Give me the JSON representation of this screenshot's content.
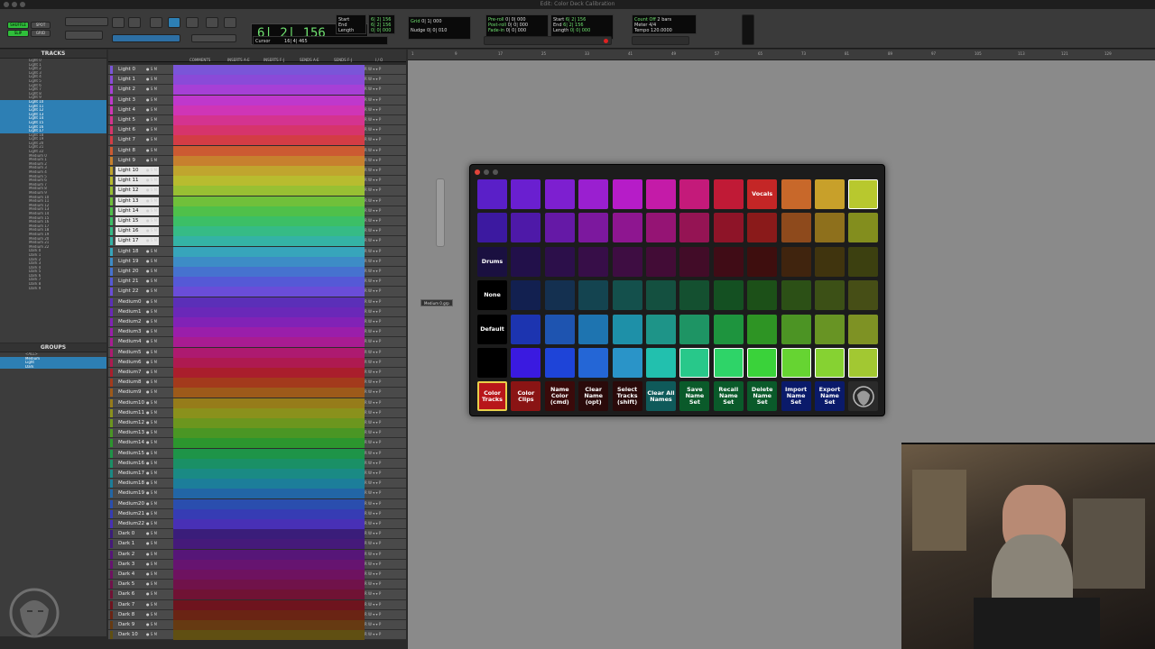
{
  "window": {
    "title": "Edit: Color Deck Calibration"
  },
  "toolbar": {
    "mode_buttons": [
      "SHUFFLE",
      "SPOT",
      "SLIP",
      "GRID"
    ],
    "counter": "6| 2| 156",
    "start_label": "Start",
    "end_label": "End",
    "length_label": "Length",
    "start": "6| 2| 156",
    "end": "6| 2| 156",
    "length": "0| 0| 000",
    "cursor_label": "Cursor",
    "cursor": "16| 4| 465",
    "grid_label": "Grid",
    "nudge_label": "Nudge",
    "grid": "0| 1| 000",
    "nudge": "0| 0| 010",
    "preroll_label": "Pre-roll",
    "postroll_label": "Post-roll",
    "fadein_label": "Fade-in",
    "preroll": "0| 0| 000",
    "postroll": "0| 0| 000",
    "fadein": "0| 0| 000",
    "pstart_label": "Start",
    "pend_label": "End",
    "plength_label": "Length",
    "pstart": "6| 2| 156",
    "pend": "6| 2| 156",
    "plength": "0| 0| 000",
    "countoff": "Count Off",
    "meter_label": "Meter",
    "tempo_label": "Tempo",
    "countoff_val": "2 bars",
    "meter": "4/4",
    "tempo": "120.0000"
  },
  "panels": {
    "tracks_title": "TRACKS",
    "groups_title": "GROUPS"
  },
  "track_list": [
    "Light 0",
    "Light 1",
    "Light 2",
    "Light 3",
    "Light 4",
    "Light 5",
    "Light 6",
    "Light 7",
    "Light 8",
    "Light 9",
    "Light 10",
    "Light 11",
    "Light 12",
    "Light 13",
    "Light 14",
    "Light 15",
    "Light 16",
    "Light 17",
    "Light 18",
    "Light 19",
    "Light 20",
    "Light 21",
    "Light 22",
    "Medium 0",
    "Medium 1",
    "Medium 2",
    "Medium 3",
    "Medium 4",
    "Medium 5",
    "Medium 6",
    "Medium 7",
    "Medium 8",
    "Medium 9",
    "Medium 10",
    "Medium 11",
    "Medium 12",
    "Medium 13",
    "Medium 14",
    "Medium 15",
    "Medium 16",
    "Medium 17",
    "Medium 18",
    "Medium 19",
    "Medium 20",
    "Medium 21",
    "Medium 22",
    "Dark 0",
    "Dark 1",
    "Dark 2",
    "Dark 3",
    "Dark 4",
    "Dark 5",
    "Dark 6",
    "Dark 7",
    "Dark 8",
    "Dark 9"
  ],
  "groups": [
    "<ALL>",
    "Medium",
    "Light",
    "Dark"
  ],
  "mix_headers": {
    "comments": "COMMENTS",
    "inserts_ae": "INSERTS A-E",
    "inserts_fj": "INSERTS F-J",
    "sends_ae": "SENDS A-E",
    "sends_fj": "SENDS F-J",
    "io": "I / O"
  },
  "tracks": [
    {
      "name": "Light 0",
      "color": "#7a55d8"
    },
    {
      "name": "Light 1",
      "color": "#8a4ad8"
    },
    {
      "name": "Light 2",
      "color": "#a640d6"
    },
    {
      "name": "Light 3",
      "color": "#bf38cc"
    },
    {
      "name": "Light 4",
      "color": "#cf35b6"
    },
    {
      "name": "Light 5",
      "color": "#d4338f"
    },
    {
      "name": "Light 6",
      "color": "#d6346b"
    },
    {
      "name": "Light 7",
      "color": "#d33c45"
    },
    {
      "name": "Light 8",
      "color": "#cc5a32"
    },
    {
      "name": "Light 9",
      "color": "#c7802e"
    },
    {
      "name": "Light 10",
      "color": "#c0a52e",
      "sel": true
    },
    {
      "name": "Light 11",
      "color": "#b8bc2f",
      "sel": true
    },
    {
      "name": "Light 12",
      "color": "#98c033",
      "sel": true
    },
    {
      "name": "Light 13",
      "color": "#70c03a",
      "sel": true
    },
    {
      "name": "Light 14",
      "color": "#4fc04a",
      "sel": true
    },
    {
      "name": "Light 15",
      "color": "#3cbf66",
      "sel": true
    },
    {
      "name": "Light 16",
      "color": "#36bb86",
      "sel": true
    },
    {
      "name": "Light 17",
      "color": "#34b3a5",
      "sel": true
    },
    {
      "name": "Light 18",
      "color": "#37a5bb"
    },
    {
      "name": "Light 19",
      "color": "#3d8cc6"
    },
    {
      "name": "Light 20",
      "color": "#4672cf"
    },
    {
      "name": "Light 21",
      "color": "#5559d6"
    },
    {
      "name": "Light 22",
      "color": "#6a4dd8"
    },
    {
      "name": "Medium0",
      "color": "#5b2fb8"
    },
    {
      "name": "Medium1",
      "color": "#6a28b8"
    },
    {
      "name": "Medium2",
      "color": "#8122b6"
    },
    {
      "name": "Medium3",
      "color": "#9a1eaa"
    },
    {
      "name": "Medium4",
      "color": "#a81c92"
    },
    {
      "name": "Medium5",
      "color": "#ad1a70"
    },
    {
      "name": "Medium6",
      "color": "#ae1a50"
    },
    {
      "name": "Medium7",
      "color": "#aa1e2c"
    },
    {
      "name": "Medium8",
      "color": "#a33a1c"
    },
    {
      "name": "Medium9",
      "color": "#9d5a1a"
    },
    {
      "name": "Medium10",
      "color": "#967c1a"
    },
    {
      "name": "Medium11",
      "color": "#8a911c"
    },
    {
      "name": "Medium12",
      "color": "#6c961e"
    },
    {
      "name": "Medium13",
      "color": "#4a9624"
    },
    {
      "name": "Medium14",
      "color": "#2c962e"
    },
    {
      "name": "Medium15",
      "color": "#1e9448"
    },
    {
      "name": "Medium16",
      "color": "#1a9066"
    },
    {
      "name": "Medium17",
      "color": "#1a8a84"
    },
    {
      "name": "Medium18",
      "color": "#1c7e9a"
    },
    {
      "name": "Medium19",
      "color": "#2266a6"
    },
    {
      "name": "Medium20",
      "color": "#2a4eae"
    },
    {
      "name": "Medium21",
      "color": "#363cb4"
    },
    {
      "name": "Medium22",
      "color": "#4830b6"
    },
    {
      "name": "Dark 0",
      "color": "#3a1d7a"
    },
    {
      "name": "Dark 1",
      "color": "#451a7a"
    },
    {
      "name": "Dark 2",
      "color": "#561678"
    },
    {
      "name": "Dark 3",
      "color": "#661470"
    },
    {
      "name": "Dark 4",
      "color": "#6e1260"
    },
    {
      "name": "Dark 5",
      "color": "#70124a"
    },
    {
      "name": "Dark 6",
      "color": "#701234"
    },
    {
      "name": "Dark 7",
      "color": "#6e141e"
    },
    {
      "name": "Dark 8",
      "color": "#6a2414"
    },
    {
      "name": "Dark 9",
      "color": "#663a12"
    },
    {
      "name": "Dark 10",
      "color": "#604f12"
    }
  ],
  "ruler_ticks": [
    "1",
    "9",
    "17",
    "25",
    "33",
    "41",
    "49",
    "57",
    "65",
    "73",
    "81",
    "89",
    "97",
    "105",
    "113",
    "121",
    "129"
  ],
  "tooltip": "Medium 0.grp",
  "deck": {
    "rows": [
      [
        {
          "c": "#5a1fc8",
          "l": ""
        },
        {
          "c": "#6a1fd0",
          "l": ""
        },
        {
          "c": "#7d1fd0",
          "l": ""
        },
        {
          "c": "#9a1fd0",
          "l": ""
        },
        {
          "c": "#b61cc8",
          "l": ""
        },
        {
          "c": "#c41ba8",
          "l": ""
        },
        {
          "c": "#c41a7a",
          "l": ""
        },
        {
          "c": "#c01a36",
          "l": ""
        },
        {
          "c": "#c42626",
          "l": "Vocals"
        },
        {
          "c": "#c8682a",
          "l": ""
        },
        {
          "c": "#c8a02a",
          "l": ""
        },
        {
          "c": "#b8c82e",
          "l": "",
          "sel": true
        }
      ],
      [
        {
          "c": "#3c19a0",
          "l": ""
        },
        {
          "c": "#4e19a8",
          "l": ""
        },
        {
          "c": "#6519a6",
          "l": ""
        },
        {
          "c": "#7c189e",
          "l": ""
        },
        {
          "c": "#8e1690",
          "l": ""
        },
        {
          "c": "#951474",
          "l": ""
        },
        {
          "c": "#951454",
          "l": ""
        },
        {
          "c": "#8e1428",
          "l": ""
        },
        {
          "c": "#8a1a1a",
          "l": ""
        },
        {
          "c": "#8e4a1c",
          "l": ""
        },
        {
          "c": "#8e701c",
          "l": ""
        },
        {
          "c": "#838e1e",
          "l": ""
        }
      ],
      [
        {
          "c": "#1a1040",
          "l": "Drums"
        },
        {
          "c": "#22104a",
          "l": ""
        },
        {
          "c": "#2c0f4a",
          "l": ""
        },
        {
          "c": "#370e48",
          "l": ""
        },
        {
          "c": "#3e0d42",
          "l": ""
        },
        {
          "c": "#420c36",
          "l": ""
        },
        {
          "c": "#420c28",
          "l": ""
        },
        {
          "c": "#400c16",
          "l": ""
        },
        {
          "c": "#3e0e0e",
          "l": ""
        },
        {
          "c": "#40240e",
          "l": ""
        },
        {
          "c": "#40340e",
          "l": ""
        },
        {
          "c": "#3c4010",
          "l": ""
        }
      ],
      [
        {
          "c": "#000000",
          "l": "None"
        },
        {
          "c": "#122050",
          "l": ""
        },
        {
          "c": "#143050",
          "l": ""
        },
        {
          "c": "#144450",
          "l": ""
        },
        {
          "c": "#14504c",
          "l": ""
        },
        {
          "c": "#145040",
          "l": ""
        },
        {
          "c": "#145030",
          "l": ""
        },
        {
          "c": "#145022",
          "l": ""
        },
        {
          "c": "#1c5018",
          "l": ""
        },
        {
          "c": "#2c5016",
          "l": ""
        },
        {
          "c": "#3c5016",
          "l": ""
        },
        {
          "c": "#464e16",
          "l": ""
        }
      ],
      [
        {
          "c": "#000000",
          "l": "Default"
        },
        {
          "c": "#1c34b0",
          "l": ""
        },
        {
          "c": "#1e54b0",
          "l": ""
        },
        {
          "c": "#1e74b0",
          "l": ""
        },
        {
          "c": "#1e90a8",
          "l": ""
        },
        {
          "c": "#1e9488",
          "l": ""
        },
        {
          "c": "#1e9464",
          "l": ""
        },
        {
          "c": "#1e943e",
          "l": ""
        },
        {
          "c": "#2e9424",
          "l": ""
        },
        {
          "c": "#4c9424",
          "l": ""
        },
        {
          "c": "#689424",
          "l": ""
        },
        {
          "c": "#7e9224",
          "l": ""
        }
      ],
      [
        {
          "c": "#000000",
          "l": ""
        },
        {
          "c": "#3a1ae0",
          "l": ""
        },
        {
          "c": "#1e44d8",
          "l": ""
        },
        {
          "c": "#2466d6",
          "l": ""
        },
        {
          "c": "#2a94c8",
          "l": ""
        },
        {
          "c": "#22c0ae",
          "l": ""
        },
        {
          "c": "#28c88a",
          "l": "",
          "sel": true
        },
        {
          "c": "#2ed468",
          "l": "",
          "sel": true
        },
        {
          "c": "#3ad23a",
          "l": "",
          "sel": true
        },
        {
          "c": "#66d432",
          "l": "",
          "sel": true
        },
        {
          "c": "#86d232",
          "l": "",
          "sel": true
        },
        {
          "c": "#a2c832",
          "l": "",
          "sel": true
        }
      ]
    ],
    "functions": [
      {
        "l": "Color Tracks",
        "c": "#b8161a",
        "sel": true
      },
      {
        "l": "Color Clips",
        "c": "#8a1414"
      },
      {
        "l": "Name Color (cmd)",
        "c": "#3a0a0a"
      },
      {
        "l": "Clear Name (opt)",
        "c": "#2a0a0a"
      },
      {
        "l": "Select Tracks (shift)",
        "c": "#2a0a0a"
      },
      {
        "l": "Clear All Names",
        "c": "#0f5a5a"
      },
      {
        "l": "Save Name Set",
        "c": "#0a5a2a"
      },
      {
        "l": "Recall Name Set",
        "c": "#0a5a2a"
      },
      {
        "l": "Delete Name Set",
        "c": "#0a5a2a"
      },
      {
        "l": "Import Name Set",
        "c": "#0a1a6a"
      },
      {
        "l": "Export Name Set",
        "c": "#0a1a6a"
      },
      {
        "l": "",
        "c": "#2a2a2a",
        "icon": "logo-icon"
      }
    ]
  }
}
